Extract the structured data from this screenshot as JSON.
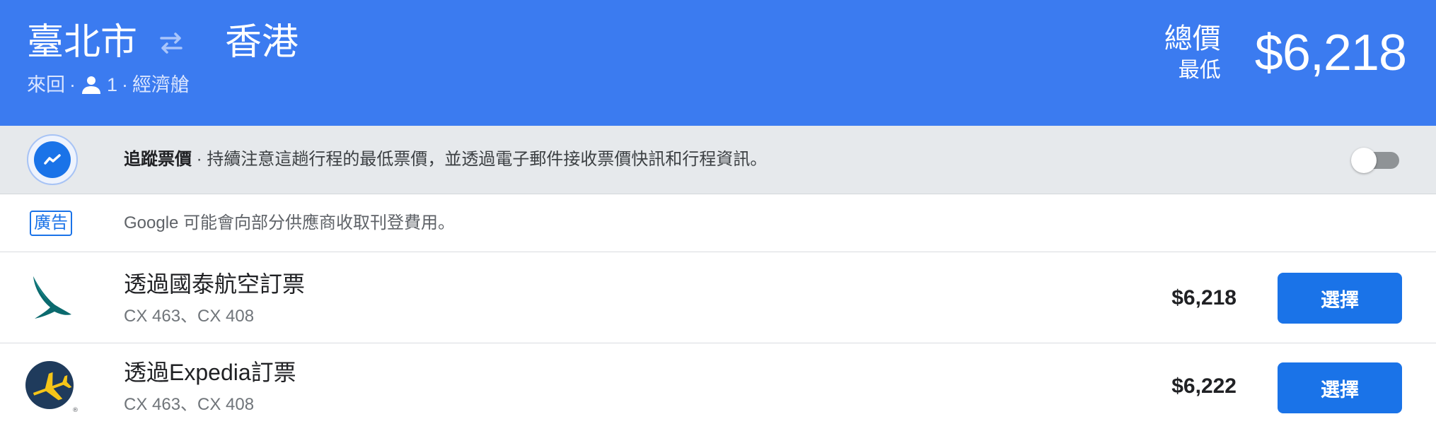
{
  "header": {
    "origin": "臺北市",
    "destination": "香港",
    "swap_icon": "swap-arrows-icon",
    "trip_type": "來回",
    "separator": "·",
    "passenger_icon": "person-icon",
    "passengers": "1",
    "cabin_class": "經濟艙",
    "price_label_top": "總價",
    "price_label_bottom": "最低",
    "lowest_price": "$6,218"
  },
  "track_prices": {
    "icon": "trend-line-icon",
    "title": "追蹤票價",
    "description": " · 持續注意這趟行程的最低票價，並透過電子郵件接收票價快訊和行程資訊。",
    "toggle_on": false
  },
  "ad": {
    "badge": "廣告",
    "text": "Google 可能會向部分供應商收取刊登費用。"
  },
  "options": [
    {
      "logo": "cathay-pacific-logo-icon",
      "title": "透過國泰航空訂票",
      "flights": "CX 463、CX 408",
      "price": "$6,218",
      "button": "選擇"
    },
    {
      "logo": "expedia-logo-icon",
      "title": "透過Expedia訂票",
      "flights": "CX 463、CX 408",
      "price": "$6,222",
      "button": "選擇"
    }
  ],
  "colors": {
    "header_bg": "#3b7bf0",
    "accent": "#1a73e8",
    "track_bg": "#e6e9ec"
  }
}
